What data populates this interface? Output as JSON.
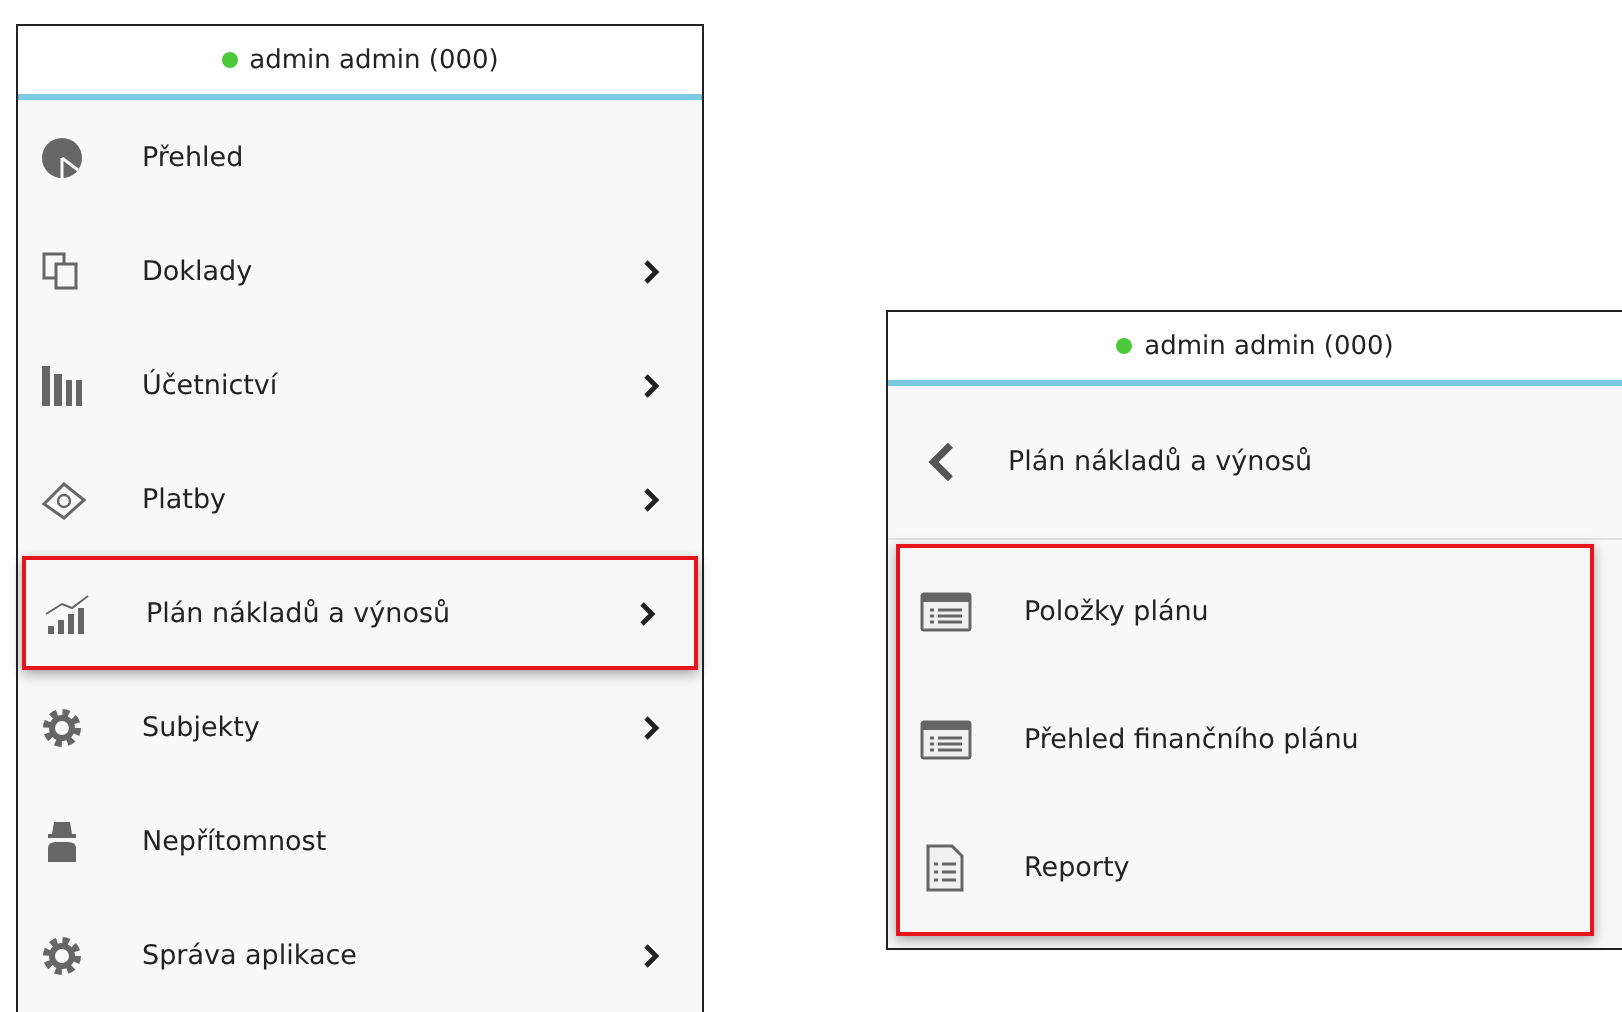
{
  "main_menu": {
    "user": {
      "name": "admin admin (000)",
      "color": "#4cc93a"
    },
    "items": [
      {
        "label": "Přehled",
        "kind": "pie",
        "has_submenu": false,
        "highlighted": false
      },
      {
        "label": "Doklady",
        "kind": "documents",
        "has_submenu": true,
        "highlighted": false
      },
      {
        "label": "Účetnictví",
        "kind": "books",
        "has_submenu": true,
        "highlighted": false
      },
      {
        "label": "Platby",
        "kind": "money",
        "has_submenu": true,
        "highlighted": false
      },
      {
        "label": "Plán nákladů a výnosů",
        "kind": "chart",
        "has_submenu": true,
        "highlighted": true
      },
      {
        "label": "Subjekty",
        "kind": "gear",
        "has_submenu": true,
        "highlighted": false
      },
      {
        "label": "Nepřítomnost",
        "kind": "agent",
        "has_submenu": false,
        "highlighted": false
      },
      {
        "label": "Správa aplikace",
        "kind": "gear",
        "has_submenu": true,
        "highlighted": false
      }
    ]
  },
  "submenu": {
    "user": {
      "name": "admin admin (000)",
      "color": "#4cc93a"
    },
    "back_title": "Plán nákladů a výnosů",
    "highlighted": true,
    "items": [
      {
        "label": "Položky plánu",
        "kind": "list"
      },
      {
        "label": "Přehled finančního plánu",
        "kind": "list"
      },
      {
        "label": "Reporty",
        "kind": "report"
      }
    ]
  }
}
